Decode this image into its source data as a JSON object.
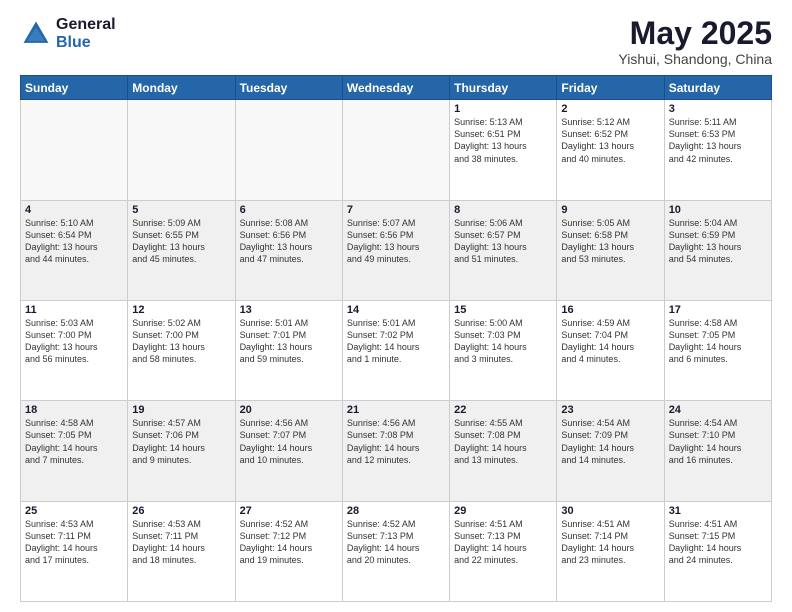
{
  "header": {
    "logo_general": "General",
    "logo_blue": "Blue",
    "title": "May 2025",
    "location": "Yishui, Shandong, China"
  },
  "days_of_week": [
    "Sunday",
    "Monday",
    "Tuesday",
    "Wednesday",
    "Thursday",
    "Friday",
    "Saturday"
  ],
  "weeks": [
    [
      {
        "day": "",
        "empty": true
      },
      {
        "day": "",
        "empty": true
      },
      {
        "day": "",
        "empty": true
      },
      {
        "day": "",
        "empty": true
      },
      {
        "day": "1",
        "info": "Sunrise: 5:13 AM\nSunset: 6:51 PM\nDaylight: 13 hours\nand 38 minutes."
      },
      {
        "day": "2",
        "info": "Sunrise: 5:12 AM\nSunset: 6:52 PM\nDaylight: 13 hours\nand 40 minutes."
      },
      {
        "day": "3",
        "info": "Sunrise: 5:11 AM\nSunset: 6:53 PM\nDaylight: 13 hours\nand 42 minutes."
      }
    ],
    [
      {
        "day": "4",
        "info": "Sunrise: 5:10 AM\nSunset: 6:54 PM\nDaylight: 13 hours\nand 44 minutes.",
        "shaded": true
      },
      {
        "day": "5",
        "info": "Sunrise: 5:09 AM\nSunset: 6:55 PM\nDaylight: 13 hours\nand 45 minutes.",
        "shaded": true
      },
      {
        "day": "6",
        "info": "Sunrise: 5:08 AM\nSunset: 6:56 PM\nDaylight: 13 hours\nand 47 minutes.",
        "shaded": true
      },
      {
        "day": "7",
        "info": "Sunrise: 5:07 AM\nSunset: 6:56 PM\nDaylight: 13 hours\nand 49 minutes.",
        "shaded": true
      },
      {
        "day": "8",
        "info": "Sunrise: 5:06 AM\nSunset: 6:57 PM\nDaylight: 13 hours\nand 51 minutes.",
        "shaded": true
      },
      {
        "day": "9",
        "info": "Sunrise: 5:05 AM\nSunset: 6:58 PM\nDaylight: 13 hours\nand 53 minutes.",
        "shaded": true
      },
      {
        "day": "10",
        "info": "Sunrise: 5:04 AM\nSunset: 6:59 PM\nDaylight: 13 hours\nand 54 minutes.",
        "shaded": true
      }
    ],
    [
      {
        "day": "11",
        "info": "Sunrise: 5:03 AM\nSunset: 7:00 PM\nDaylight: 13 hours\nand 56 minutes."
      },
      {
        "day": "12",
        "info": "Sunrise: 5:02 AM\nSunset: 7:00 PM\nDaylight: 13 hours\nand 58 minutes."
      },
      {
        "day": "13",
        "info": "Sunrise: 5:01 AM\nSunset: 7:01 PM\nDaylight: 13 hours\nand 59 minutes."
      },
      {
        "day": "14",
        "info": "Sunrise: 5:01 AM\nSunset: 7:02 PM\nDaylight: 14 hours\nand 1 minute."
      },
      {
        "day": "15",
        "info": "Sunrise: 5:00 AM\nSunset: 7:03 PM\nDaylight: 14 hours\nand 3 minutes."
      },
      {
        "day": "16",
        "info": "Sunrise: 4:59 AM\nSunset: 7:04 PM\nDaylight: 14 hours\nand 4 minutes."
      },
      {
        "day": "17",
        "info": "Sunrise: 4:58 AM\nSunset: 7:05 PM\nDaylight: 14 hours\nand 6 minutes."
      }
    ],
    [
      {
        "day": "18",
        "info": "Sunrise: 4:58 AM\nSunset: 7:05 PM\nDaylight: 14 hours\nand 7 minutes.",
        "shaded": true
      },
      {
        "day": "19",
        "info": "Sunrise: 4:57 AM\nSunset: 7:06 PM\nDaylight: 14 hours\nand 9 minutes.",
        "shaded": true
      },
      {
        "day": "20",
        "info": "Sunrise: 4:56 AM\nSunset: 7:07 PM\nDaylight: 14 hours\nand 10 minutes.",
        "shaded": true
      },
      {
        "day": "21",
        "info": "Sunrise: 4:56 AM\nSunset: 7:08 PM\nDaylight: 14 hours\nand 12 minutes.",
        "shaded": true
      },
      {
        "day": "22",
        "info": "Sunrise: 4:55 AM\nSunset: 7:08 PM\nDaylight: 14 hours\nand 13 minutes.",
        "shaded": true
      },
      {
        "day": "23",
        "info": "Sunrise: 4:54 AM\nSunset: 7:09 PM\nDaylight: 14 hours\nand 14 minutes.",
        "shaded": true
      },
      {
        "day": "24",
        "info": "Sunrise: 4:54 AM\nSunset: 7:10 PM\nDaylight: 14 hours\nand 16 minutes.",
        "shaded": true
      }
    ],
    [
      {
        "day": "25",
        "info": "Sunrise: 4:53 AM\nSunset: 7:11 PM\nDaylight: 14 hours\nand 17 minutes."
      },
      {
        "day": "26",
        "info": "Sunrise: 4:53 AM\nSunset: 7:11 PM\nDaylight: 14 hours\nand 18 minutes."
      },
      {
        "day": "27",
        "info": "Sunrise: 4:52 AM\nSunset: 7:12 PM\nDaylight: 14 hours\nand 19 minutes."
      },
      {
        "day": "28",
        "info": "Sunrise: 4:52 AM\nSunset: 7:13 PM\nDaylight: 14 hours\nand 20 minutes."
      },
      {
        "day": "29",
        "info": "Sunrise: 4:51 AM\nSunset: 7:13 PM\nDaylight: 14 hours\nand 22 minutes."
      },
      {
        "day": "30",
        "info": "Sunrise: 4:51 AM\nSunset: 7:14 PM\nDaylight: 14 hours\nand 23 minutes."
      },
      {
        "day": "31",
        "info": "Sunrise: 4:51 AM\nSunset: 7:15 PM\nDaylight: 14 hours\nand 24 minutes."
      }
    ]
  ]
}
